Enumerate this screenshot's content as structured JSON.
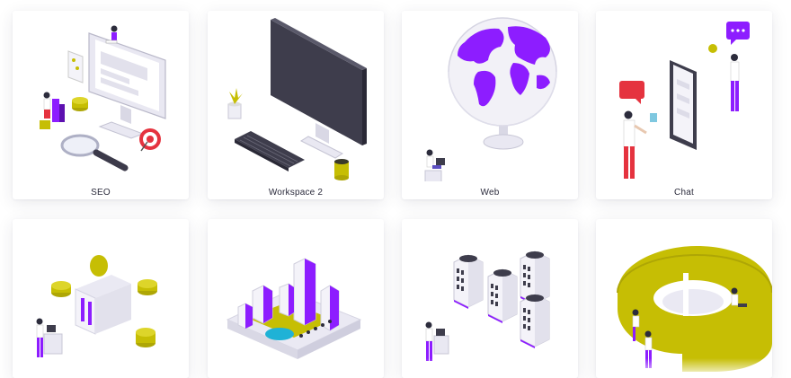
{
  "illustrations": [
    {
      "label": "SEO",
      "icon": "seo-icon"
    },
    {
      "label": "Workspace 2",
      "icon": "workspace-icon"
    },
    {
      "label": "Web",
      "icon": "globe-icon"
    },
    {
      "label": "Chat",
      "icon": "chat-icon"
    },
    {
      "label": "",
      "icon": "finance-icon"
    },
    {
      "label": "",
      "icon": "city-icon"
    },
    {
      "label": "",
      "icon": "server-icon"
    },
    {
      "label": "",
      "icon": "chart-icon"
    }
  ],
  "colors": {
    "purple": "#8d1dff",
    "olive": "#c6be04",
    "dark": "#3c3a4a",
    "red": "#e5333f"
  }
}
